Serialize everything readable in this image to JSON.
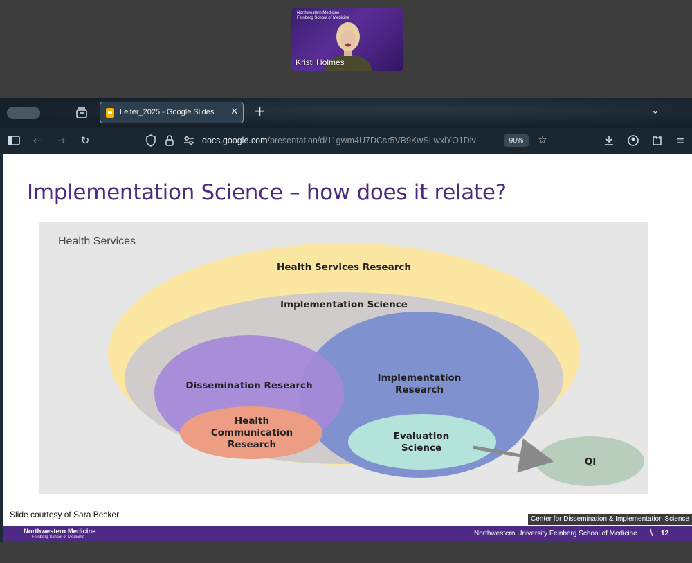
{
  "video": {
    "org_line1": "Northwestern Medicine",
    "org_line2": "Feinberg School of Medicine",
    "participant_name": "Kristi Holmes"
  },
  "browser": {
    "tab_title": "Leiter_2025 - Google Slides",
    "url_host": "docs.google.com",
    "url_path": "/presentation/d/11gwm4U7DCsr5VB9KwSLwxiYO1Dlv",
    "zoom": "90%",
    "icons": [
      "sidebar-icon",
      "back-icon",
      "forward-icon",
      "reload-icon",
      "shield-icon",
      "lock-icon",
      "permissions-icon",
      "star-icon",
      "download-icon",
      "account-icon",
      "extensions-icon",
      "menu-icon"
    ]
  },
  "slide": {
    "title": "Implementation Science – how does it relate?",
    "outer_label": "Health Services",
    "labels": {
      "hsr": "Health Services Research",
      "impl_sci": "Implementation Science",
      "dissemination": "Dissemination Research",
      "impl_research": "Implementation Research",
      "health_comm": "Health Communication Research",
      "evaluation": "Evaluation Science",
      "qi": "QI"
    },
    "courtesy": "Slide courtesy of Sara Becker",
    "center_tag": "Center for Dissemination & Implementation Science",
    "footer_logo": "Northwestern Medicine",
    "footer_logo_sub": "Feinberg School of Medicine",
    "footer_school": "Northwestern University Feinberg School of Medicine",
    "page_number": "12"
  },
  "colors": {
    "title_purple": "#4e2a84",
    "hsr_yellow": "#fbe7a1",
    "impl_gray": "#d0cccc",
    "dissemination_purple": "#a58ad8",
    "impl_research_blue": "#7f92cf",
    "health_comm_salmon": "#ec9d84",
    "evaluation_mint": "#b4e3dc",
    "qi_sage": "#b8cdbb"
  }
}
